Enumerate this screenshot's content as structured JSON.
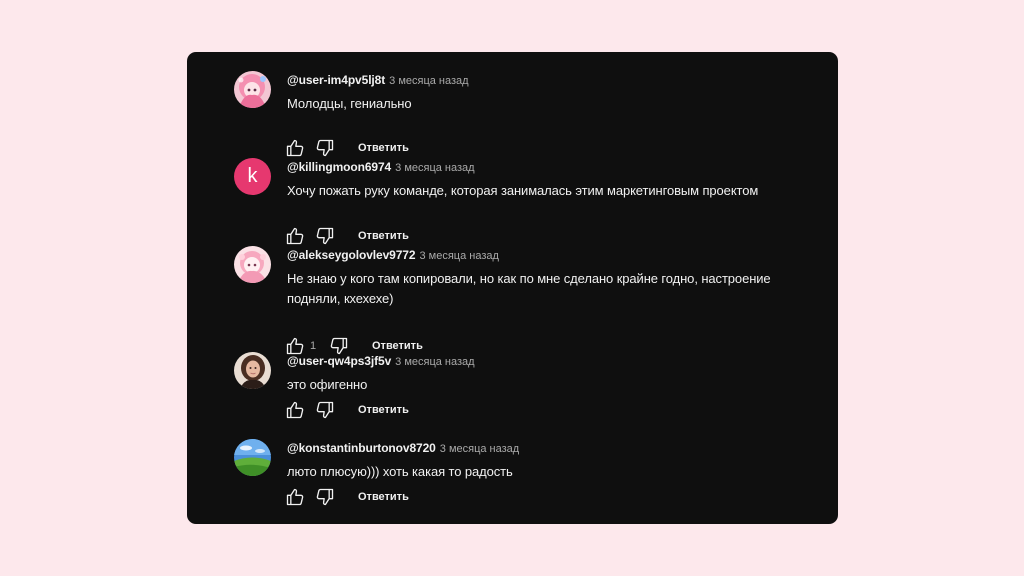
{
  "comments": [
    {
      "author": "@user-im4pv5lj8t",
      "time": "3 месяца назад",
      "text": "Молодцы, гениально",
      "avatar_icon": "anime-avatar-icon",
      "reply_label": "Ответить"
    },
    {
      "author": "@killingmoon6974",
      "time": "3 месяца назад",
      "text": "Хочу пожать руку команде, которая занималась этим маркетинговым проектом",
      "avatar_letter": "k",
      "avatar_color": "#e6386f",
      "reply_label": "Ответить"
    },
    {
      "author": "@alekseygolovlev9772",
      "time": "3 месяца назад",
      "text": "Не знаю у кого там копировали, но как по мне сделано крайне годно, настроение подняли, кхехехе)",
      "avatar_icon": "anime-avatar-icon",
      "like_count": "1",
      "reply_label": "Ответить"
    },
    {
      "author": "@user-qw4ps3jf5v",
      "time": "3 месяца назад",
      "text": "это офигенно",
      "avatar_icon": "photo-avatar-icon",
      "reply_label": "Ответить"
    },
    {
      "author": "@konstantinburtonov8720",
      "time": "3 месяца назад",
      "text": "люто плюсую))) хоть какая то радость",
      "avatar_icon": "landscape-avatar-icon",
      "reply_label": "Ответить"
    }
  ],
  "colors": {
    "page_background": "#fde8ec",
    "panel_background": "#0f0f0f",
    "text_primary": "#f1f1f1",
    "text_secondary": "#aaaaaa"
  }
}
